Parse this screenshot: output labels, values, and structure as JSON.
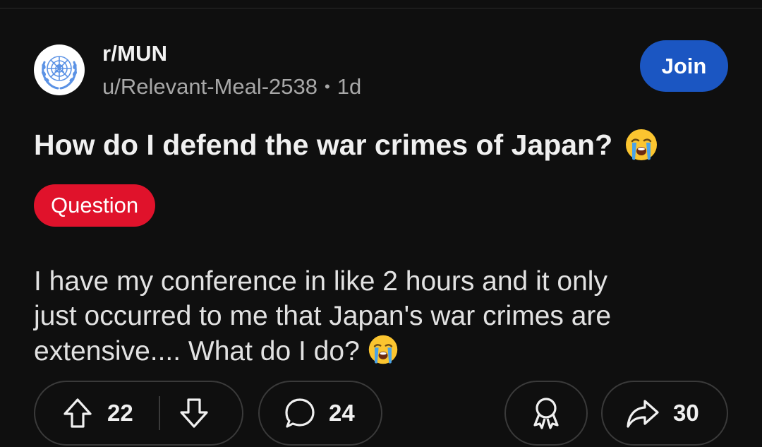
{
  "post": {
    "subreddit": "r/MUN",
    "author": "u/Relevant-Meal-2538",
    "separator": "•",
    "age": "1d",
    "join_label": "Join",
    "title": "How do I defend the war crimes of Japan?",
    "flair": "Question",
    "body_lines": [
      "I have my conference in like 2 hours and it only",
      "just occurred to me that Japan's war crimes are",
      "extensive.... What do I do?"
    ]
  },
  "actions": {
    "upvotes": "22",
    "comments": "24",
    "shares": "30"
  },
  "colors": {
    "background": "#0f0f0f",
    "join_button": "#1b56c2",
    "flair": "#e0122b",
    "pill_border": "#3a3a3a",
    "emoji_yellow": "#fbc530",
    "emoji_tears": "#4aa3e8"
  },
  "icons": {
    "avatar": "un-emblem-icon",
    "title_emoji": "loudly-crying-face-icon",
    "upvote": "upvote-arrow-icon",
    "downvote": "downvote-arrow-icon",
    "comment": "comment-bubble-icon",
    "award": "award-icon",
    "share": "share-arrow-icon"
  }
}
